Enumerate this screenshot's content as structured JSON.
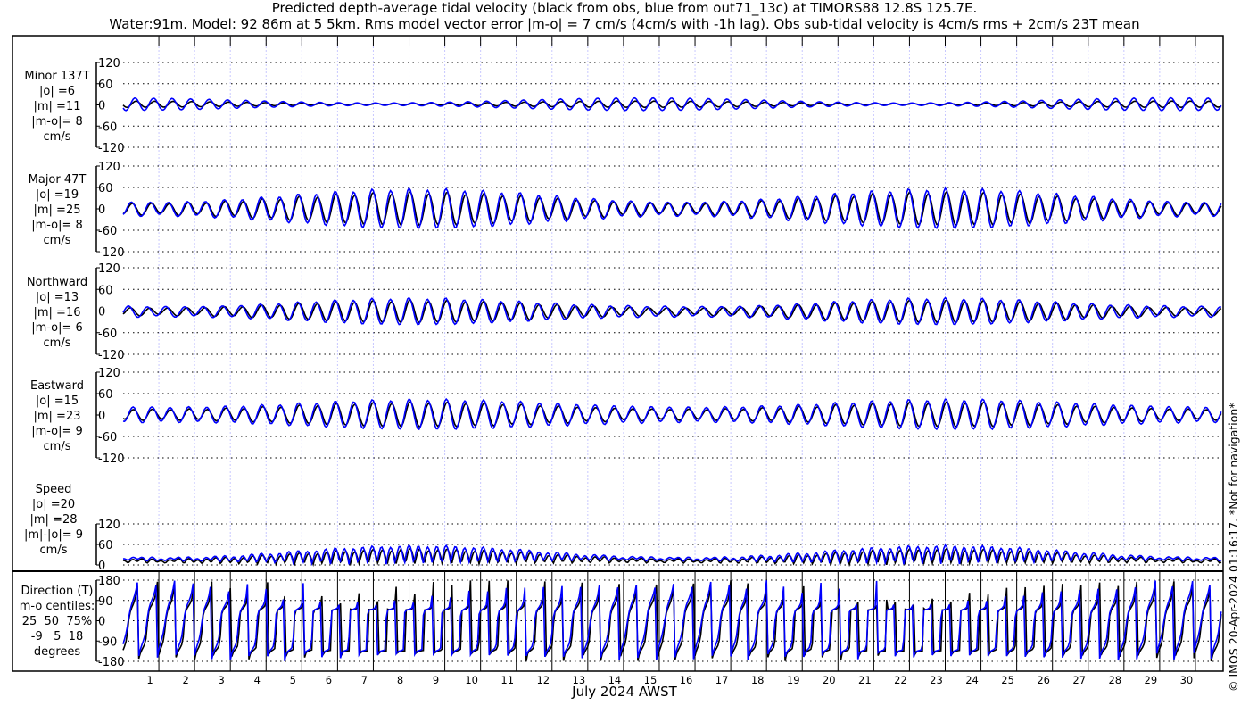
{
  "chart_data": {
    "type": "line",
    "title": "Predicted depth-average tidal velocity (black from obs, blue from out71_13c) at TIMORS88 12.8S 125.7E.",
    "subtitle": "Water:91m. Model: 92 86m at 5 5km. Rms model vector error |m-o| = 7 cm/s (4cm/s with -1h lag). Obs sub-tidal velocity is 4cm/s rms + 2cm/s 23T mean",
    "xlabel": "July 2024 AWST",
    "x_ticks": [
      "1",
      "2",
      "3",
      "4",
      "5",
      "6",
      "7",
      "8",
      "9",
      "10",
      "11",
      "12",
      "13",
      "14",
      "15",
      "16",
      "17",
      "18",
      "19",
      "20",
      "21",
      "22",
      "23",
      "24",
      "25",
      "26",
      "27",
      "28",
      "29",
      "30"
    ],
    "xlim_days": [
      0.25,
      31.0
    ],
    "series": [
      {
        "name": "obs",
        "color": "#000000"
      },
      {
        "name": "model out71_13c",
        "color": "#0000ff"
      }
    ],
    "grid_color": "#c8c8ff",
    "tidal_signal": {
      "semidiurnal_period_hours": 12.42,
      "diurnal_period_hours": 24.0,
      "spring_neap_period_days": 14.77,
      "spring_peak_day": 8.5,
      "major_axis_deg": 47,
      "minor_axis_deg": 137,
      "obs_major_spring": 45,
      "obs_major_neap": 15,
      "model_major_spring": 55,
      "model_major_neap": 18,
      "obs_minor": 9,
      "model_minor": 18
    },
    "panels": [
      {
        "key": "minor",
        "label": [
          "Minor 137T",
          "|o| =6",
          "|m| =11",
          "|m-o|= 8",
          "cm/s"
        ],
        "ylim": [
          -120,
          120
        ],
        "yticks": [
          "120",
          "60",
          "0",
          "-60",
          "-120"
        ]
      },
      {
        "key": "major",
        "label": [
          "Major 47T",
          "|o| =19",
          "|m| =25",
          "|m-o|= 8",
          "cm/s"
        ],
        "ylim": [
          -120,
          120
        ],
        "yticks": [
          "120",
          "60",
          "0",
          "-60",
          "-120"
        ]
      },
      {
        "key": "north",
        "label": [
          "Northward",
          "|o| =13",
          "|m| =16",
          "|m-o|= 6",
          "cm/s"
        ],
        "ylim": [
          -120,
          120
        ],
        "yticks": [
          "120",
          "60",
          "0",
          "-60",
          "-120"
        ]
      },
      {
        "key": "east",
        "label": [
          "Eastward",
          "|o| =15",
          "|m| =23",
          "|m-o|= 9",
          "cm/s"
        ],
        "ylim": [
          -120,
          120
        ],
        "yticks": [
          "120",
          "60",
          "0",
          "-60",
          "-120"
        ]
      },
      {
        "key": "speed",
        "label": [
          "Speed",
          "|o| =20",
          "|m| =28",
          "|m|-|o|= 9",
          "cm/s"
        ],
        "ylim": [
          0,
          120
        ],
        "yticks": [
          "120",
          "60",
          "0"
        ]
      },
      {
        "key": "direction",
        "label": [
          "Direction (T)",
          "m-o centiles:",
          "25  50  75%",
          "-9   5  18",
          "degrees"
        ],
        "ylim": [
          -180,
          180
        ],
        "yticks": [
          "180",
          "90",
          "0",
          "-90",
          "-180"
        ]
      }
    ]
  },
  "copyright": "© IMOS 20-Apr-2024 01:16:17. *Not for navigation*"
}
